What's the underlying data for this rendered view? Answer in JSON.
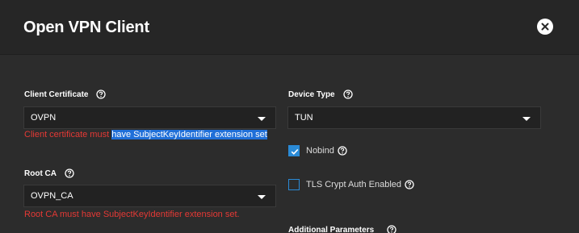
{
  "dialog": {
    "title": "Open VPN Client"
  },
  "client_certificate": {
    "label": "Client Certificate",
    "value": "OVPN",
    "error_prefix": "Client certificate must ",
    "error_highlight": "have SubjectKeyIdentifier extension set"
  },
  "root_ca": {
    "label": "Root CA",
    "value": "OVPN_CA",
    "error": "Root CA must have SubjectKeyIdentifier extension set."
  },
  "device_type": {
    "label": "Device Type",
    "value": "TUN"
  },
  "nobind": {
    "label": "Nobind",
    "checked": true
  },
  "tls_crypt_auth": {
    "label": "TLS Crypt Auth Enabled",
    "checked": false
  },
  "additional_parameters": {
    "label": "Additional Parameters"
  },
  "colors": {
    "background": "#2c2c2c",
    "header": "#262626",
    "error": "#e53935",
    "accent": "#2a8ad6",
    "selection": "#1f6fd8"
  }
}
